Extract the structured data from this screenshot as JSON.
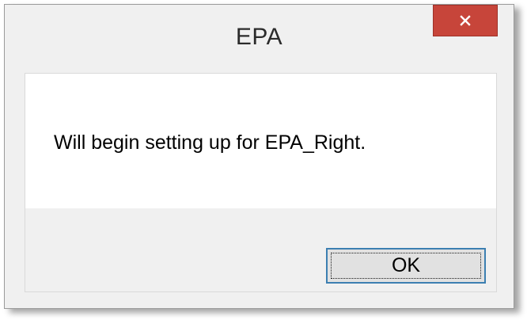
{
  "dialog": {
    "title": "EPA",
    "close_icon": "close-icon",
    "message": "Will begin setting up for EPA_Right.",
    "ok_label": "OK"
  },
  "colors": {
    "close_button": "#c7453a",
    "window_background": "#f0f0f0",
    "message_background": "#ffffff",
    "ok_border": "#3c7fb1"
  }
}
